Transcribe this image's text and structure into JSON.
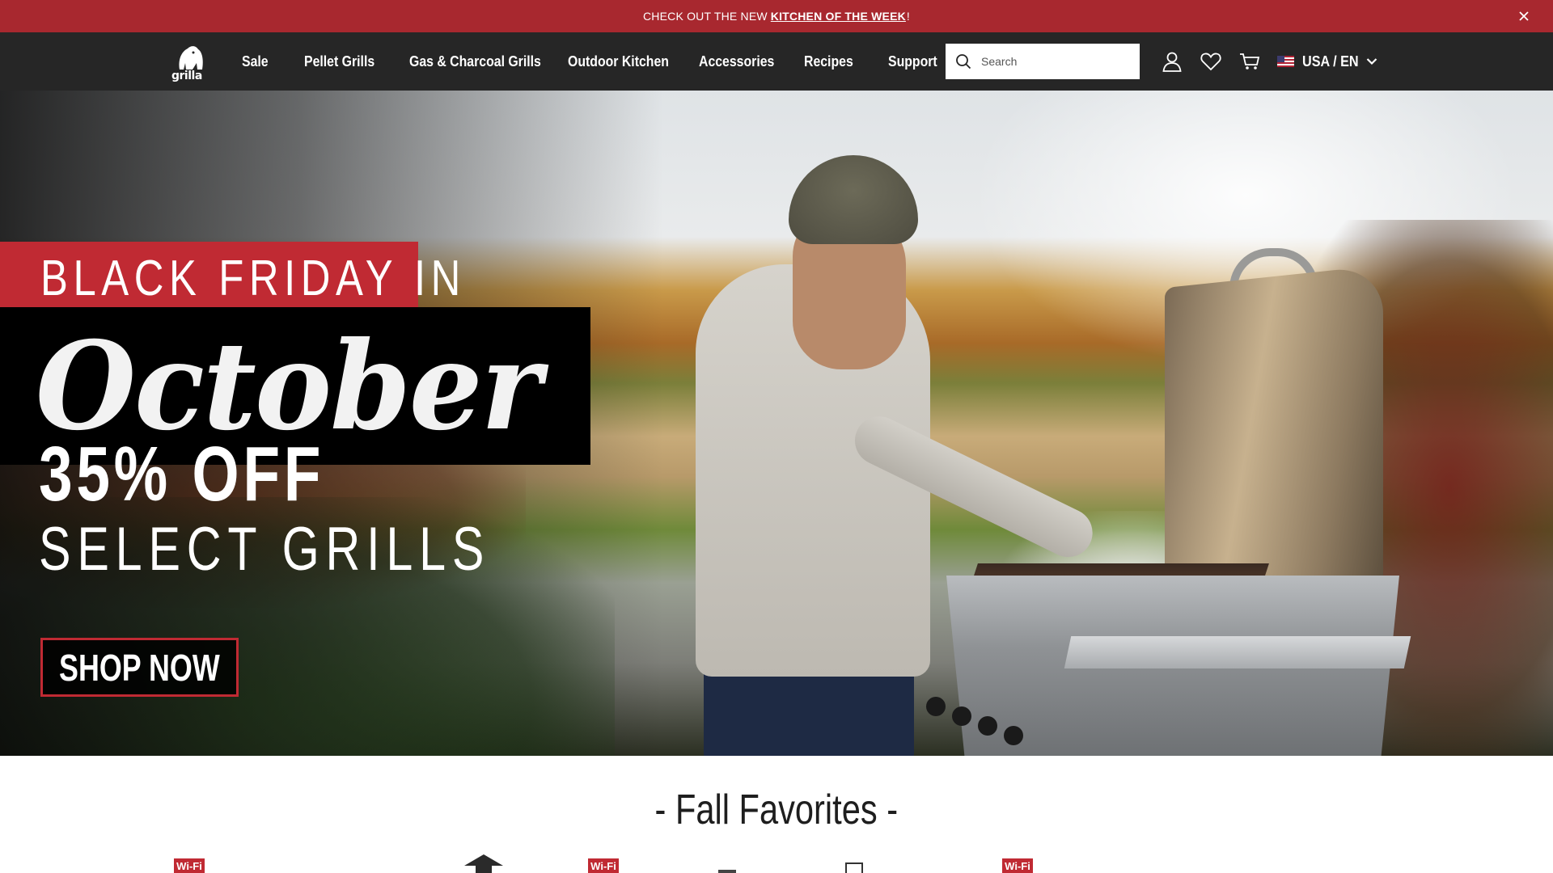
{
  "announcement": {
    "prefix": "CHECK OUT THE NEW",
    "link": "KITCHEN OF THE WEEK",
    "suffix": "!",
    "close_icon": "close-icon"
  },
  "nav": {
    "logo_text": "grilla",
    "items": [
      "Sale",
      "Pellet Grills",
      "Gas & Charcoal Grills",
      "Outdoor Kitchen",
      "Accessories",
      "Recipes",
      "Support"
    ],
    "search": {
      "placeholder": "Search",
      "value": ""
    },
    "icons": [
      "account-icon",
      "wishlist-heart-icon",
      "cart-icon"
    ],
    "locale": "USA / EN"
  },
  "hero": {
    "line1": "BLACK FRIDAY IN",
    "line2": "October",
    "offer": "35% OFF",
    "offer_sub": "SELECT GRILLS",
    "cta": "SHOP NOW",
    "colors": {
      "accent_red": "#c02a33",
      "announce_red": "#a8282f",
      "nav_bg": "#262626"
    }
  },
  "section": {
    "title": "- Fall Favorites -",
    "badges": [
      "Wi-Fi",
      "Wi-Fi",
      "Wi-Fi"
    ]
  }
}
